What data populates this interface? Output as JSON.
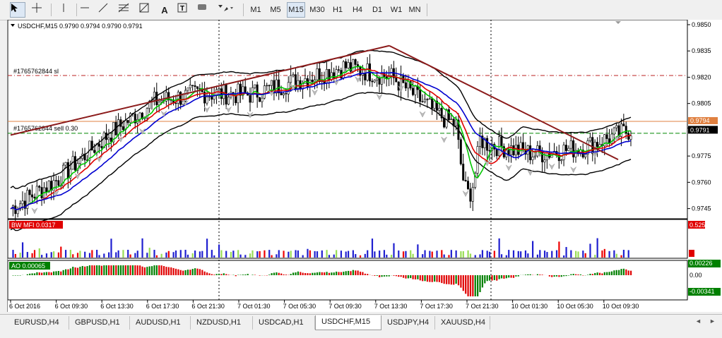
{
  "toolbar": {
    "tools": [
      {
        "name": "cursor-icon",
        "glyph": "➤"
      },
      {
        "name": "crosshair-icon",
        "glyph": "+"
      },
      {
        "name": "vertical-line-icon",
        "glyph": "|"
      },
      {
        "name": "horizontal-line-icon",
        "glyph": "—"
      },
      {
        "name": "trendline-icon",
        "glyph": "╱"
      },
      {
        "name": "fibonacci-icon",
        "glyph": "≣"
      },
      {
        "name": "gann-icon",
        "glyph": "▦"
      },
      {
        "name": "text-icon",
        "glyph": "A"
      },
      {
        "name": "text-label-icon",
        "glyph": "T"
      },
      {
        "name": "rectangle-icon",
        "glyph": "▬"
      },
      {
        "name": "arrows-icon",
        "glyph": "⇲"
      }
    ],
    "timeframes": [
      "M1",
      "M5",
      "M15",
      "M30",
      "H1",
      "H4",
      "D1",
      "W1",
      "MN"
    ],
    "active_timeframe": "M15"
  },
  "chart": {
    "header": "USDCHF,M15  0.9790 0.9794 0.9790 0.9791",
    "order_sl_label": "#1765762844 sl",
    "order_sell_label": "#1765762844 sell 0.30",
    "price_ticks": [
      "0.9850",
      "0.9835",
      "0.9820",
      "0.9805",
      "0.9791",
      "0.9775",
      "0.9760",
      "0.9745"
    ],
    "current_price_label": "0.9791",
    "order_price_label": "0.9794",
    "bwmfi_label": "BW MFI 0.0317",
    "bwmfi_max": "0.525",
    "ao_label": "AO 0.00065",
    "ao_ticks": [
      "0.00226",
      "0.00",
      "-0.00341"
    ],
    "time_labels": [
      "6 Oct 2016",
      "6 Oct 09:30",
      "6 Oct 13:30",
      "6 Oct 17:30",
      "6 Oct 21:30",
      "7 Oct 01:30",
      "7 Oct 05:30",
      "7 Oct 09:30",
      "7 Oct 13:30",
      "7 Oct 17:30",
      "7 Oct 21:30",
      "10 Oct 01:30",
      "10 Oct 05:30",
      "10 Oct 09:30"
    ],
    "colors": {
      "bull": "#000000",
      "bear": "#000000",
      "ma_green": "#00c800",
      "ma_red": "#e00000",
      "ma_blue": "#0000d0",
      "trend": "#8b1a1a",
      "bw_bar": "#1f1fd0",
      "ao_up": "#008000",
      "ao_down": "#e00000"
    }
  },
  "chart_data": {
    "type": "line",
    "symbol": "USDCHF",
    "timeframe": "M15",
    "ohlc_last": {
      "open": 0.979,
      "high": 0.9794,
      "low": 0.979,
      "close": 0.9791
    },
    "x": [
      "6 Oct 2016",
      "6 Oct 09:30",
      "6 Oct 13:30",
      "6 Oct 17:30",
      "6 Oct 21:30",
      "7 Oct 01:30",
      "7 Oct 05:30",
      "7 Oct 09:30",
      "7 Oct 13:30",
      "7 Oct 17:30",
      "7 Oct 21:30",
      "10 Oct 01:30",
      "10 Oct 05:30",
      "10 Oct 09:30"
    ],
    "series": [
      {
        "values": [
          0.9745,
          0.9762,
          0.9786,
          0.9806,
          0.9811,
          0.981,
          0.9818,
          0.9826,
          0.982,
          0.9798,
          0.9782,
          0.9776,
          0.978,
          0.979
        ]
      }
    ],
    "ylim": [
      0.974,
      0.9852
    ],
    "levels": {
      "sl": 0.9821,
      "sell": 0.9788,
      "current": 0.9791,
      "ask": 0.9794
    }
  },
  "tabs": [
    {
      "label": "EURUSD,H4"
    },
    {
      "label": "GBPUSD,H1"
    },
    {
      "label": "AUDUSD,H1"
    },
    {
      "label": "NZDUSD,H1"
    },
    {
      "label": "USDCAD,H1"
    },
    {
      "label": "USDCHF,M15"
    },
    {
      "label": "USDJPY,H4"
    },
    {
      "label": "XAUUSD,H4"
    }
  ],
  "active_tab": "USDCHF,M15"
}
